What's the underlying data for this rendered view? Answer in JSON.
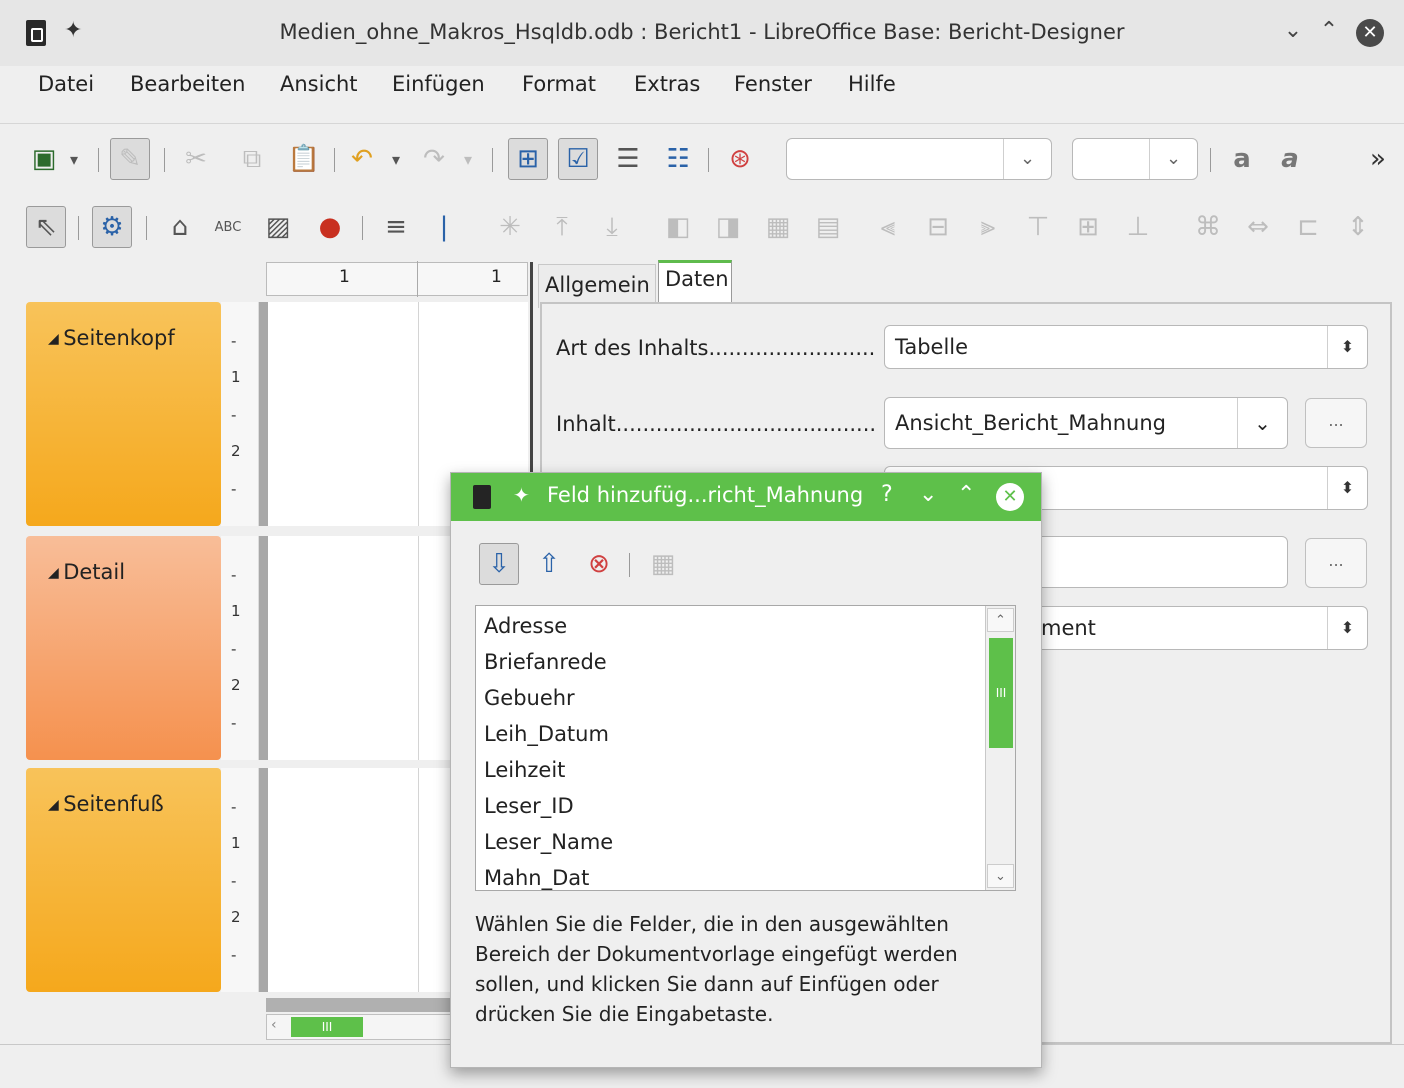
{
  "window": {
    "title": "Medien_ohne_Makros_Hsqldb.odb : Bericht1 - LibreOffice Base: Bericht-Designer",
    "icons": [
      "document-icon",
      "pin-icon",
      "minimize-icon",
      "maximize-icon",
      "close-icon"
    ]
  },
  "menu": [
    "Datei",
    "Bearbeiten",
    "Ansicht",
    "Einfügen",
    "Format",
    "Extras",
    "Fenster",
    "Hilfe"
  ],
  "ruler": {
    "label_a": "1",
    "label_b": "1"
  },
  "sections": [
    {
      "label": "Seitenkopf",
      "color": "#f7b32a"
    },
    {
      "label": "Detail",
      "color": "#f59a62"
    },
    {
      "label": "Seitenfuß",
      "color": "#f7b32a"
    }
  ],
  "vruler_marks": [
    "-",
    "1",
    "-",
    "2",
    "-"
  ],
  "scrollbar_thumb": "III",
  "panel": {
    "tabs": [
      "Allgemein",
      "Daten"
    ],
    "art_label": "Art des Inhalts.........................",
    "art_value": "Tabelle",
    "inhalt_label": "Inhalt.......................................",
    "inhalt_value": "Ansicht_Bericht_Mahnung",
    "dots": "...",
    "partial_value": "ment"
  },
  "dialog": {
    "title": "Feld hinzufüg...richt_Mahnung",
    "help_btn": "?",
    "fields": [
      "Adresse",
      "Briefanrede",
      "Gebuehr",
      "Leih_Datum",
      "Leihzeit",
      "Leser_ID",
      "Leser_Name",
      "Mahn_Dat"
    ],
    "help_text": "Wählen Sie die Felder, die in den ausgewählten Bereich der Dokumentvorlage eingefügt werden sollen, und klicken Sie dann auf Einfügen oder drücken Sie die Eingabetaste.",
    "scroll_thumb": "III"
  },
  "colors": {
    "accent": "#5ec04a",
    "section_orange": "#f7b32a",
    "section_salmon": "#f59a62"
  }
}
